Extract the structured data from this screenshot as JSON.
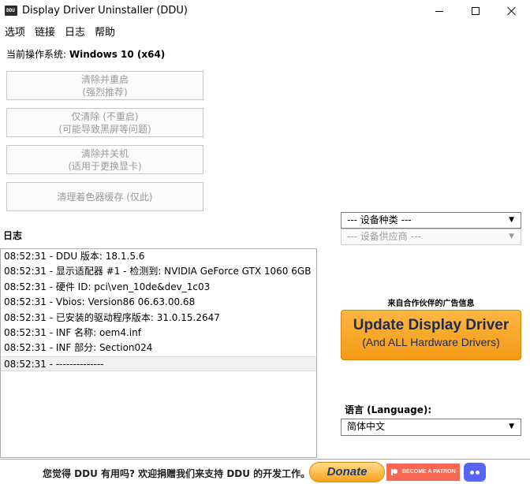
{
  "window": {
    "title": "Display Driver Uninstaller (DDU)",
    "icon_text": "DDU"
  },
  "menu": {
    "items": [
      "选项",
      "链接",
      "日志",
      "帮助"
    ]
  },
  "os": {
    "label": "当前操作系统:",
    "value": "Windows 10 (x64)"
  },
  "actions": [
    {
      "line1": "清除并重启",
      "line2": "(强烈推荐)"
    },
    {
      "line1": "仅清除 (不重启)",
      "line2": "(可能导致黑屏等问题)"
    },
    {
      "line1": "清除并关机",
      "line2": "(适用于更换显卡)"
    },
    {
      "line1": "清理着色器缓存 (仅此)",
      "line2": ""
    }
  ],
  "log": {
    "label": "日志",
    "entries": [
      "08:52:31 - DDU 版本: 18.1.5.6",
      "08:52:31 - 显示适配器 #1 - 检测到: NVIDIA GeForce GTX 1060 6GB",
      "08:52:31 - 硬件 ID: pci\\ven_10de&dev_1c03",
      "08:52:31 - Vbios: Version86 06.63.00.68",
      "08:52:31 - 已安装的驱动程序版本: 31.0.15.2647",
      "08:52:31 - INF 名称: oem4.inf",
      "08:52:31 - INF 部分: Section024",
      "08:52:31 - --------------"
    ],
    "selected_index": 7
  },
  "device_type": {
    "value": "--- 设备种类 ---"
  },
  "device_vendor": {
    "value": "--- 设备供应商 ---"
  },
  "ad": {
    "label": "来自合作伙伴的广告信息",
    "title": "Update Display Driver",
    "subtitle": "(And ALL Hardware Drivers)"
  },
  "language": {
    "label": "语言 (Language):",
    "value": "简体中文"
  },
  "footer": {
    "text": "您觉得 DDU 有用吗? 欢迎捐赠我们来支持 DDU 的开发工作。",
    "donate_label": "Donate",
    "patreon_label": "BECOME A PATRON"
  },
  "colors": {
    "ad_orange": "#f39a16",
    "ad_text": "#1d2b56",
    "patreon": "#f96854",
    "discord": "#5865f2"
  }
}
